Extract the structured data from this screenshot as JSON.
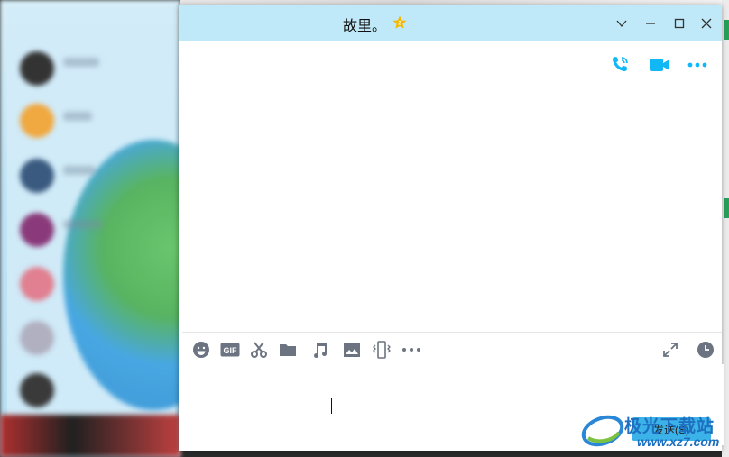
{
  "window": {
    "title": "故里。"
  },
  "titlebar_buttons": [
    "chevron-down-icon",
    "minimize-icon",
    "maximize-icon",
    "close-icon"
  ],
  "action_bar": [
    "voice-call-icon",
    "video-call-icon",
    "more-icon"
  ],
  "toolbar": [
    "emoji-icon",
    "gif-icon",
    "screenshot-scissors-icon",
    "folder-icon",
    "music-icon",
    "image-icon",
    "shake-icon",
    "more-dots-icon",
    "expand-icon",
    "history-clock-icon"
  ],
  "composer": {
    "value": "",
    "send_label": "发送(S)"
  },
  "watermark": {
    "text": "极光下载站",
    "url": "www.xz7.com"
  },
  "colors": {
    "titlebar": "#bfe8f8",
    "accent_icon": "#12b7f5",
    "send_button": "#3cb3e8",
    "star": "#f5b800"
  }
}
